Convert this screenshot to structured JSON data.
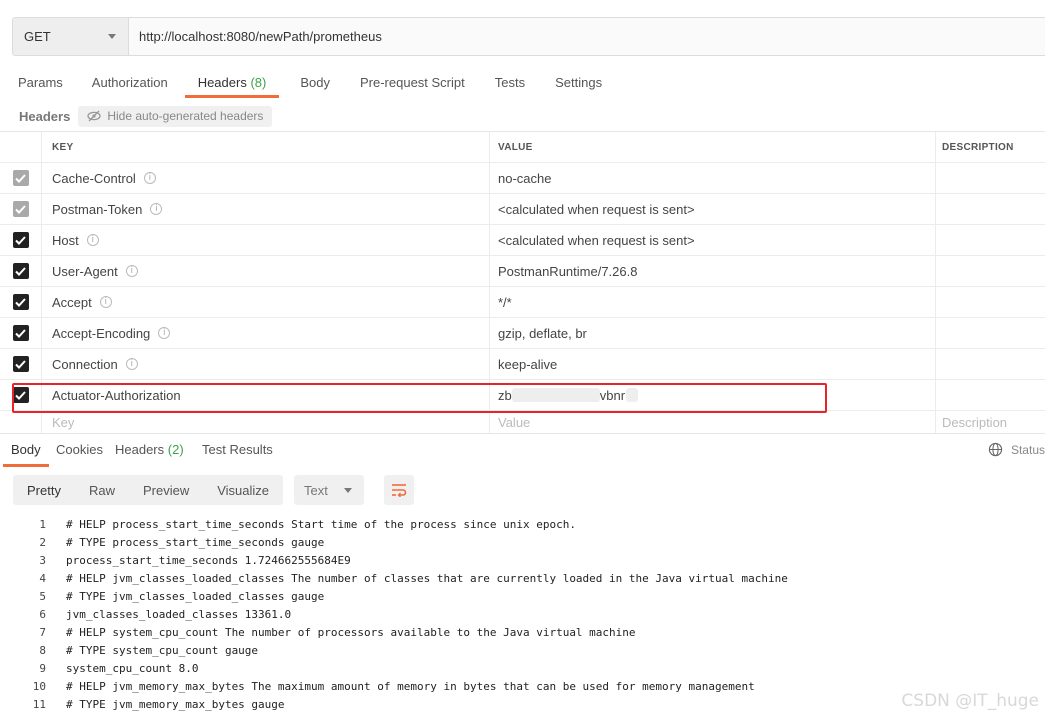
{
  "request": {
    "method": "GET",
    "url": "http://localhost:8080/newPath/prometheus"
  },
  "request_tabs": [
    {
      "label": "Params"
    },
    {
      "label": "Authorization"
    },
    {
      "label": "Headers",
      "count": "(8)"
    },
    {
      "label": "Body"
    },
    {
      "label": "Pre-request Script"
    },
    {
      "label": "Tests"
    },
    {
      "label": "Settings"
    }
  ],
  "headers_section": {
    "title": "Headers",
    "hide_label": "Hide auto-generated headers"
  },
  "table": {
    "columns": {
      "key": "KEY",
      "value": "VALUE",
      "description": "DESCRIPTION"
    },
    "rows": [
      {
        "key": "Cache-Control",
        "value": "no-cache"
      },
      {
        "key": "Postman-Token",
        "value": "<calculated when request is sent>"
      },
      {
        "key": "Host",
        "value": "<calculated when request is sent>"
      },
      {
        "key": "User-Agent",
        "value": "PostmanRuntime/7.26.8"
      },
      {
        "key": "Accept",
        "value": "*/*"
      },
      {
        "key": "Accept-Encoding",
        "value": "gzip, deflate, br"
      },
      {
        "key": "Connection",
        "value": "keep-alive"
      },
      {
        "key": "Actuator-Authorization",
        "value_start": "zb",
        "value_end": "vbnr"
      }
    ],
    "new_row": {
      "key": "Key",
      "value": "Value",
      "description": "Description"
    }
  },
  "response_tabs": [
    {
      "label": "Body"
    },
    {
      "label": "Cookies"
    },
    {
      "label": "Headers",
      "count": "(2)"
    },
    {
      "label": "Test Results"
    }
  ],
  "status_label": "Status",
  "view_modes": [
    "Pretty",
    "Raw",
    "Preview",
    "Visualize"
  ],
  "format": "Text",
  "code_lines": [
    {
      "n": "1",
      "t": "# HELP process_start_time_seconds Start time of the process since unix epoch."
    },
    {
      "n": "2",
      "t": "# TYPE process_start_time_seconds gauge"
    },
    {
      "n": "3",
      "t": "process_start_time_seconds 1.724662555684E9"
    },
    {
      "n": "4",
      "t": "# HELP jvm_classes_loaded_classes The number of classes that are currently loaded in the Java virtual machine"
    },
    {
      "n": "5",
      "t": "# TYPE jvm_classes_loaded_classes gauge"
    },
    {
      "n": "6",
      "t": "jvm_classes_loaded_classes 13361.0"
    },
    {
      "n": "7",
      "t": "# HELP system_cpu_count The number of processors available to the Java virtual machine"
    },
    {
      "n": "8",
      "t": "# TYPE system_cpu_count gauge"
    },
    {
      "n": "9",
      "t": "system_cpu_count 8.0"
    },
    {
      "n": "10",
      "t": "# HELP jvm_memory_max_bytes The maximum amount of memory in bytes that can be used for memory management"
    },
    {
      "n": "11",
      "t": "# TYPE jvm_memory_max_bytes gauge"
    }
  ],
  "watermark": "CSDN @IT_huge",
  "colors": {
    "accent": "#f26b3a",
    "count_green": "#3fa14b",
    "highlight_red": "#e8232a"
  }
}
